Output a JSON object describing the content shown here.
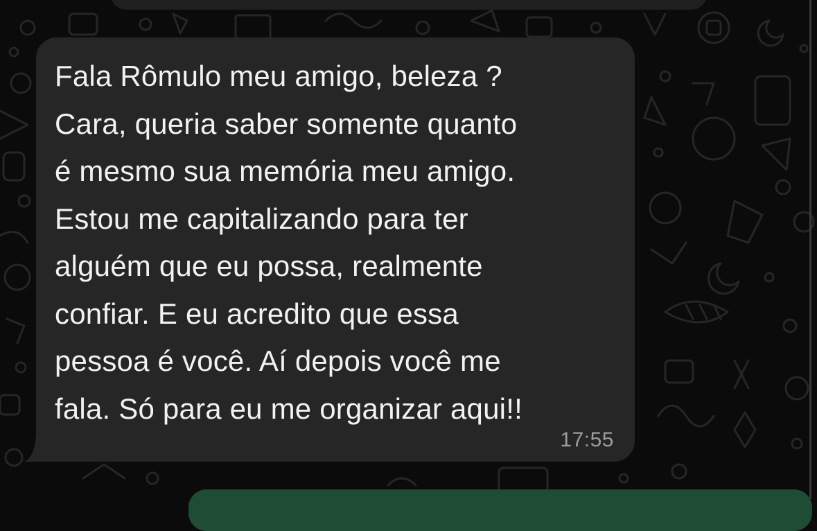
{
  "chat": {
    "incoming_message": {
      "lines": [
        "Fala Rômulo meu amigo, beleza ?",
        "Cara, queria saber somente quanto",
        "é mesmo sua memória meu amigo.",
        "Estou me capitalizando para ter",
        "alguém que eu possa, realmente",
        "confiar. E eu acredito que essa",
        "pessoa é você. Aí depois você me",
        "fala. Só para eu me organizar aqui!!"
      ],
      "time": "17:55"
    }
  },
  "colors": {
    "background": "#0b0b0b",
    "incoming_bubble": "#262626",
    "outgoing_bubble": "#1e4d33",
    "text": "#f2f2f2",
    "timestamp": "#9d9d9d"
  }
}
